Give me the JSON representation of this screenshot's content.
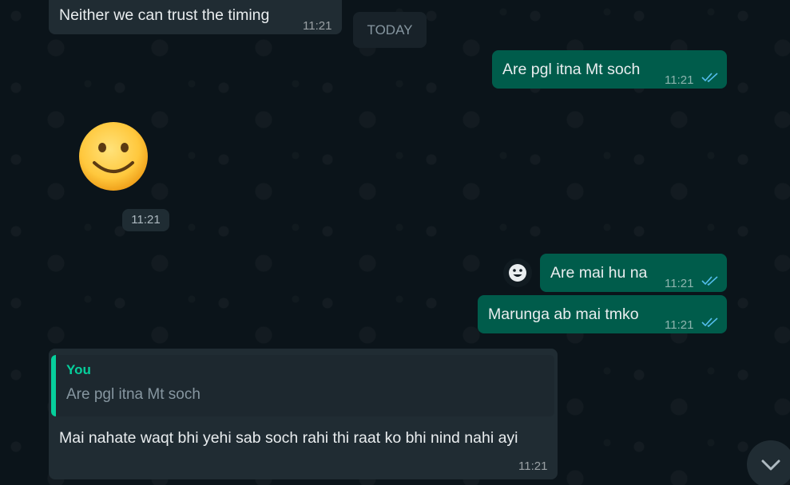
{
  "messages": {
    "m1": {
      "text": "Neither we can trust the timing",
      "time": "11:21"
    },
    "date_chip": "TODAY",
    "m2": {
      "text": "Are pgl itna Mt soch",
      "time": "11:21"
    },
    "m3": {
      "emoji": "smiling-face",
      "time": "11:21"
    },
    "m4": {
      "text": "Are mai hu na",
      "time": "11:21"
    },
    "m5": {
      "text": "Marunga ab mai tmko",
      "time": "11:21"
    },
    "m6": {
      "quote_author": "You",
      "quote_text": "Are pgl itna Mt soch",
      "text": "Mai nahate waqt bhi yehi sab soch rahi thi raat ko bhi nind nahi ayi",
      "time": "11:21"
    }
  },
  "colors": {
    "background": "#0b141a",
    "incoming": "#202c33",
    "outgoing": "#005c4b",
    "read_ticks": "#53bdeb",
    "quote_accent": "#06cf9c"
  }
}
